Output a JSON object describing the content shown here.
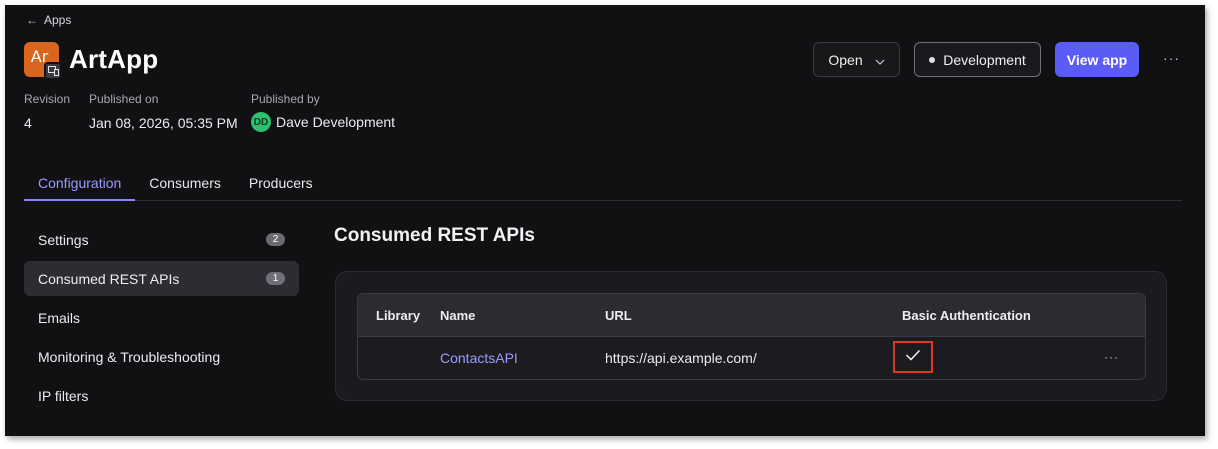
{
  "breadcrumb": {
    "back_label": "Apps"
  },
  "app": {
    "icon_abbr": "Ar",
    "title": "ArtApp",
    "accent_color": "#d9661f"
  },
  "meta": {
    "revision_label": "Revision",
    "revision_value": "4",
    "published_on_label": "Published on",
    "published_on_value": "Jan 08, 2026, 05:35 PM",
    "published_by_label": "Published by",
    "published_by_initials": "DD",
    "published_by_name": "Dave Development"
  },
  "header_actions": {
    "open_label": "Open",
    "environment_label": "Development",
    "view_label": "View app",
    "more_label": "···",
    "primary_color": "#5b5bf5"
  },
  "tabs": [
    {
      "label": "Configuration",
      "active": true
    },
    {
      "label": "Consumers",
      "active": false
    },
    {
      "label": "Producers",
      "active": false
    }
  ],
  "sidebar": {
    "items": [
      {
        "label": "Settings",
        "count": "2",
        "active": false
      },
      {
        "label": "Consumed REST APIs",
        "count": "1",
        "active": true
      },
      {
        "label": "Emails",
        "active": false
      },
      {
        "label": "Monitoring & Troubleshooting",
        "active": false
      },
      {
        "label": "IP filters",
        "active": false
      }
    ]
  },
  "main": {
    "title": "Consumed REST APIs",
    "table": {
      "columns": [
        "Library",
        "Name",
        "URL",
        "Basic Authentication"
      ],
      "rows": [
        {
          "library": "",
          "name": "ContactsAPI",
          "url": "https://api.example.com/",
          "basic_auth": true,
          "more_label": "···"
        }
      ]
    },
    "highlight_color": "#d93a22"
  }
}
